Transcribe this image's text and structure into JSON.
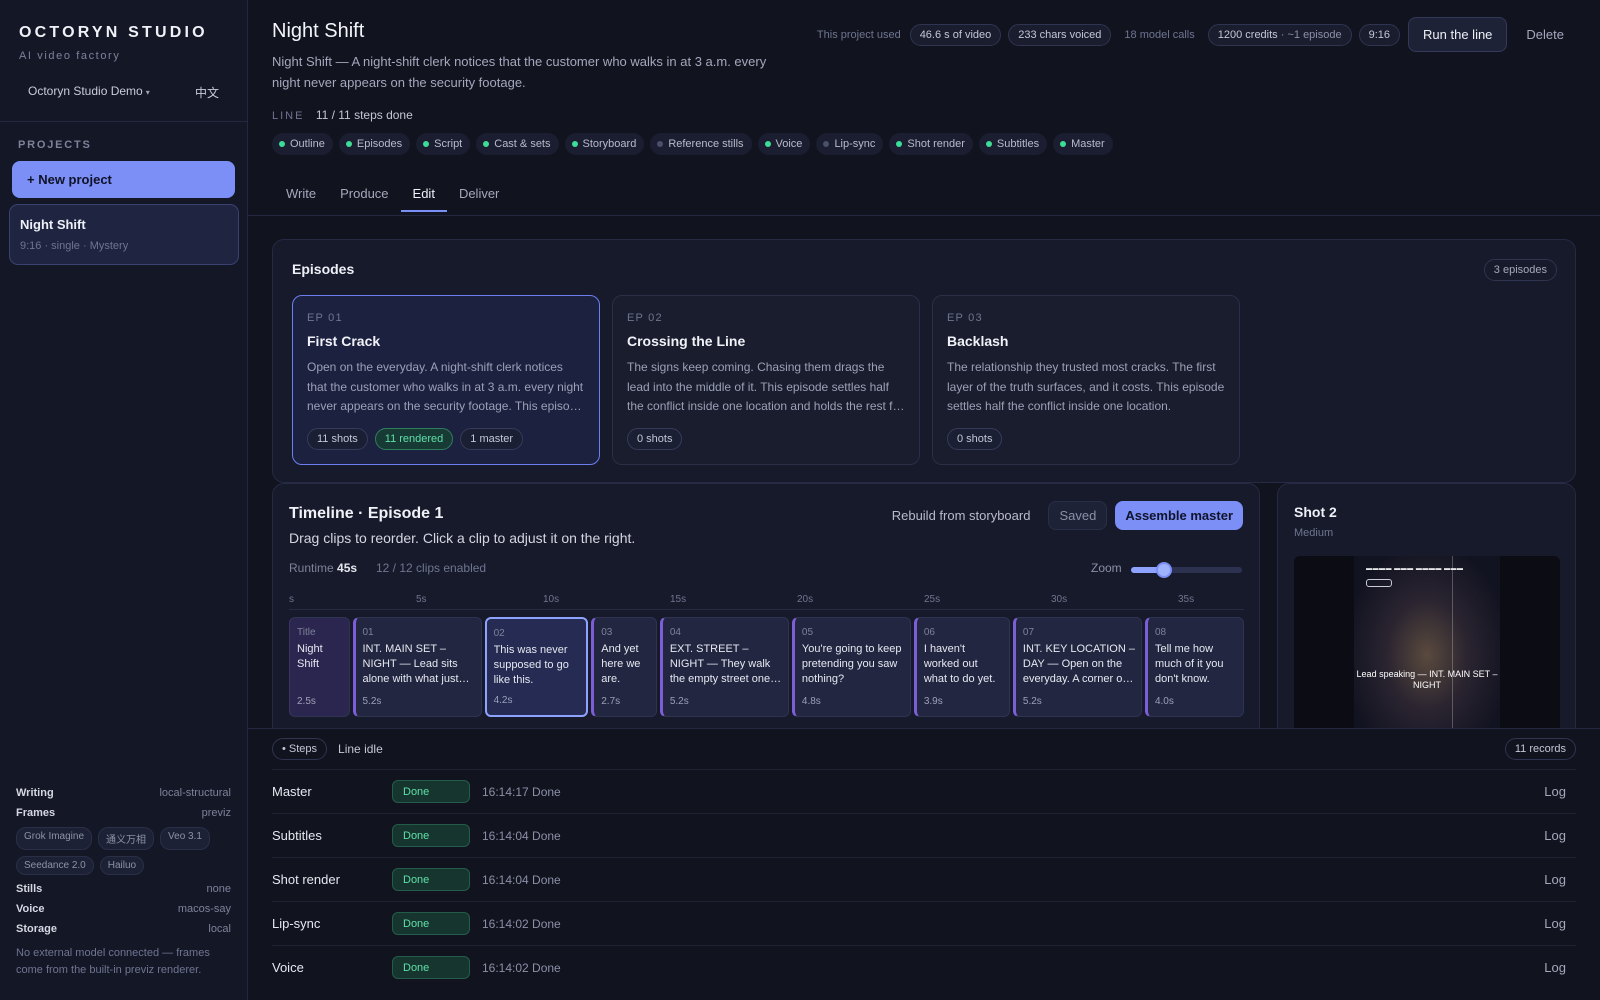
{
  "sidebar": {
    "brand": "OCTORYN STUDIO",
    "tagline": "AI video factory",
    "workspace": "Octoryn Studio Demo",
    "language": "中文",
    "projects_heading": "PROJECTS",
    "new_project": "+ New project",
    "projects": [
      {
        "name": "Night Shift",
        "meta": "9:16 · single · Mystery"
      }
    ],
    "settings": {
      "writing": {
        "k": "Writing",
        "v": "local-structural"
      },
      "frames": {
        "k": "Frames",
        "v": "previz"
      },
      "frame_models": [
        "Grok Imagine",
        "通义万相",
        "Veo 3.1",
        "Seedance 2.0",
        "Hailuo"
      ],
      "stills": {
        "k": "Stills",
        "v": "none"
      },
      "voice": {
        "k": "Voice",
        "v": "macos-say"
      },
      "storage": {
        "k": "Storage",
        "v": "local"
      }
    },
    "note": "No external model connected — frames come from the built-in previz renderer."
  },
  "header": {
    "title": "Night Shift",
    "description": "Night Shift — A night-shift clerk notices that the customer who walks in at 3 a.m. every night never appears on the security footage.",
    "usage_label": "This project used",
    "video_seconds": "46.6 s of video",
    "chars_voiced": "233 chars voiced",
    "model_calls": "18 model calls",
    "credits": "1200 credits",
    "credits_note": "· ~1 episode",
    "aspect": "9:16",
    "run_button": "Run the line",
    "delete_button": "Delete"
  },
  "line": {
    "label": "LINE",
    "progress": "11 / 11 steps done",
    "steps": [
      {
        "label": "Outline",
        "done": true
      },
      {
        "label": "Episodes",
        "done": true
      },
      {
        "label": "Script",
        "done": true
      },
      {
        "label": "Cast & sets",
        "done": true
      },
      {
        "label": "Storyboard",
        "done": true
      },
      {
        "label": "Reference stills",
        "done": false
      },
      {
        "label": "Voice",
        "done": true
      },
      {
        "label": "Lip-sync",
        "done": false
      },
      {
        "label": "Shot render",
        "done": true
      },
      {
        "label": "Subtitles",
        "done": true
      },
      {
        "label": "Master",
        "done": true
      }
    ]
  },
  "tabs": [
    "Write",
    "Produce",
    "Edit",
    "Deliver"
  ],
  "episodes": {
    "heading": "Episodes",
    "count": "3 episodes",
    "items": [
      {
        "no": "EP 01",
        "title": "First Crack",
        "desc": "Open on the everyday. A night-shift clerk notices that the customer who walks in at 3 a.m. every night never appears on the security footage. This episode settles half the conflict inside one location.",
        "chips": [
          "11 shots",
          "11 rendered",
          "1 master"
        ]
      },
      {
        "no": "EP 02",
        "title": "Crossing the Line",
        "desc": "The signs keep coming. Chasing them drags the lead into the middle of it. This episode settles half the conflict inside one location and holds the rest for later.",
        "chips": [
          "0 shots"
        ]
      },
      {
        "no": "EP 03",
        "title": "Backlash",
        "desc": "The relationship they trusted most cracks. The first layer of the truth surfaces, and it costs. This episode settles half the conflict inside one location.",
        "chips": [
          "0 shots"
        ]
      }
    ]
  },
  "timeline": {
    "title": "Timeline · Episode 1",
    "subtitle": "Drag clips to reorder. Click a clip to adjust it on the right.",
    "rebuild": "Rebuild from storyboard",
    "saved": "Saved",
    "assemble": "Assemble master",
    "runtime_label": "Runtime",
    "runtime": "45s",
    "enabled": "12 / 12 clips enabled",
    "zoom_label": "Zoom",
    "zoom_fraction": 0.3,
    "ruler": [
      "s",
      "5s",
      "10s",
      "15s",
      "20s",
      "25s",
      "30s",
      "35s"
    ],
    "clips": [
      {
        "no": "Title",
        "text": "Night Shift",
        "dur": "2.5s"
      },
      {
        "no": "01",
        "text": "INT. MAIN SET – NIGHT — Lead sits alone with what just happened.",
        "dur": "5.2s"
      },
      {
        "no": "02",
        "text": "This was never supposed to go like this.",
        "dur": "4.2s"
      },
      {
        "no": "03",
        "text": "And yet here we are.",
        "dur": "2.7s"
      },
      {
        "no": "04",
        "text": "EXT. STREET – NIGHT — They walk the empty street one more time.",
        "dur": "5.2s"
      },
      {
        "no": "05",
        "text": "You're going to keep pretending you saw nothing?",
        "dur": "4.8s"
      },
      {
        "no": "06",
        "text": "I haven't worked out what to do yet.",
        "dur": "3.9s"
      },
      {
        "no": "07",
        "text": "INT. KEY LOCATION – DAY — Open on the everyday. A corner of the store.",
        "dur": "5.2s"
      },
      {
        "no": "08",
        "text": "Tell me how much of it you don't know.",
        "dur": "4.0s"
      }
    ]
  },
  "shot": {
    "title": "Shot 2",
    "framing": "Medium",
    "caption": "Lead speaking — INT. MAIN SET – NIGHT"
  },
  "log": {
    "steps_button": "• Steps",
    "status": "Line idle",
    "records": "11 records",
    "rows": [
      {
        "name": "Master",
        "status": "Done",
        "time": "16:14:17 Done",
        "action": "Log"
      },
      {
        "name": "Subtitles",
        "status": "Done",
        "time": "16:14:04 Done",
        "action": "Log"
      },
      {
        "name": "Shot render",
        "status": "Done",
        "time": "16:14:04 Done",
        "action": "Log"
      },
      {
        "name": "Lip-sync",
        "status": "Done",
        "time": "16:14:02 Done",
        "action": "Log"
      },
      {
        "name": "Voice",
        "status": "Done",
        "time": "16:14:02 Done",
        "action": "Log"
      }
    ]
  },
  "colors": {
    "accent": "#7b8ff7",
    "done": "#3ddc97",
    "background": "#11131f"
  }
}
